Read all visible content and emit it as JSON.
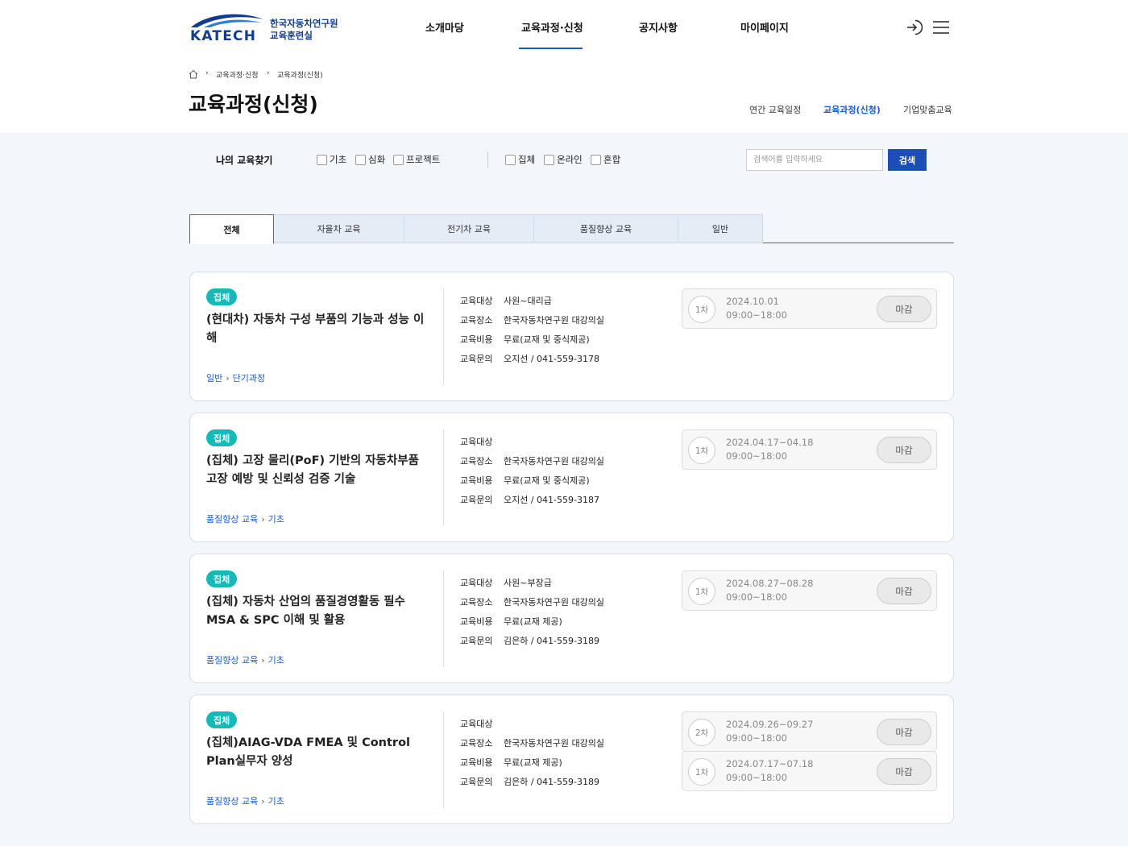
{
  "header": {
    "logo": {
      "word": "KATECH",
      "org_line1": "한국자동차연구원",
      "org_line2": "교육훈련실"
    },
    "nav": [
      "소개마당",
      "교육과정·신청",
      "공지사항",
      "마이페이지"
    ],
    "login_icon": "login-icon",
    "menu_icon": "hamburger-menu-icon",
    "accent_color": "#1b5bc8"
  },
  "breadcrumb": {
    "home_icon": "home-icon",
    "items": [
      "교육과정·신청",
      "교육과정(신청)"
    ]
  },
  "page_title": "교육과정(신청)",
  "sub_tabs": [
    "연간 교육일정",
    "교육과정(신청)",
    "기업맞춤교육"
  ],
  "filter": {
    "label": "나의 교육찾기",
    "level_options": [
      "기초",
      "심화",
      "프로젝트"
    ],
    "type_options": [
      "집체",
      "온라인",
      "혼합"
    ],
    "search_placeholder": "검색어를 입력하세요",
    "search_button": "검색"
  },
  "category_tabs": [
    "전체",
    "자율차 교육",
    "전기차 교육",
    "품질향상 교육",
    "일반"
  ],
  "info_labels": {
    "target": "교육대상",
    "place": "교육장소",
    "cost": "교육비용",
    "contact": "교육문의"
  },
  "courses": [
    {
      "badge": "집체",
      "title": "(현대차) 자동차 구성 부품의 기능과 성능 이해",
      "category": [
        "일반",
        "단기과정"
      ],
      "target": "사원~대리급",
      "place": "한국자동차연구원 대강의실",
      "cost": "무료(교재 및 중식제공)",
      "contact": "오지선 / 041-559-3178",
      "sessions": [
        {
          "round": "1차",
          "date": "2024.10.01",
          "time": "09:00~18:00",
          "status": "마감"
        }
      ]
    },
    {
      "badge": "집체",
      "title": "(집체) 고장 물리(PoF) 기반의 자동차부품 고장 예방 및 신뢰성 검증 기술",
      "category": [
        "품질향상 교육",
        "기초"
      ],
      "target": "",
      "place": "한국자동차연구원 대강의실",
      "cost": "무료(교재 및 중식제공)",
      "contact": "오지선 / 041-559-3187",
      "sessions": [
        {
          "round": "1차",
          "date": "2024.04.17~04.18",
          "time": "09:00~18:00",
          "status": "마감"
        }
      ]
    },
    {
      "badge": "집체",
      "title": "(집체) 자동차 산업의 품질경영활동 필수 MSA & SPC 이해 및 활용",
      "category": [
        "품질향상 교육",
        "기초"
      ],
      "target": "사원~부장급",
      "place": "한국자동차연구원 대강의실",
      "cost": "무료(교재 제공)",
      "contact": "김은하 / 041-559-3189",
      "sessions": [
        {
          "round": "1차",
          "date": "2024.08.27~08.28",
          "time": "09:00~18:00",
          "status": "마감"
        }
      ]
    },
    {
      "badge": "집체",
      "title": "(집체)AIAG-VDA FMEA 및 Control Plan실무자 양성",
      "category": [
        "품질향상 교육",
        "기초"
      ],
      "target": "",
      "place": "한국자동차연구원 대강의실",
      "cost": "무료(교재 제공)",
      "contact": "김은하 / 041-559-3189",
      "sessions": [
        {
          "round": "2차",
          "date": "2024.09.26~09.27",
          "time": "09:00~18:00",
          "status": "마감"
        },
        {
          "round": "1차",
          "date": "2024.07.17~07.18",
          "time": "09:00~18:00",
          "status": "마감"
        }
      ]
    }
  ]
}
